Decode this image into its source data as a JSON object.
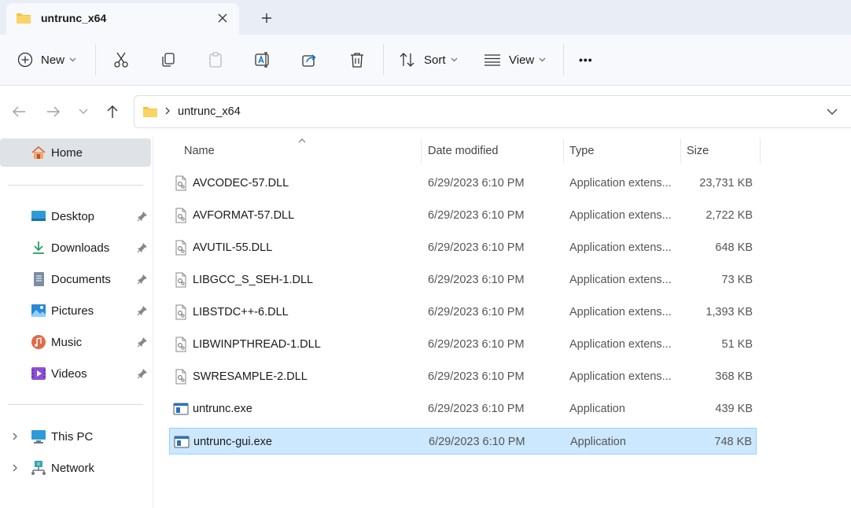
{
  "window": {
    "tab_title": "untrunc_x64"
  },
  "toolbar": {
    "new_label": "New",
    "sort_label": "Sort",
    "view_label": "View",
    "more_label": "•••"
  },
  "address": {
    "path": [
      "untrunc_x64"
    ]
  },
  "sidebar": {
    "home": "Home",
    "quick_access": [
      {
        "label": "Desktop",
        "icon": "desktop-icon"
      },
      {
        "label": "Downloads",
        "icon": "downloads-icon"
      },
      {
        "label": "Documents",
        "icon": "documents-icon"
      },
      {
        "label": "Pictures",
        "icon": "pictures-icon"
      },
      {
        "label": "Music",
        "icon": "music-icon"
      },
      {
        "label": "Videos",
        "icon": "videos-icon"
      }
    ],
    "this_pc": "This PC",
    "network": "Network"
  },
  "columns": {
    "name": "Name",
    "date": "Date modified",
    "type": "Type",
    "size": "Size"
  },
  "files": [
    {
      "name": "AVCODEC-57.DLL",
      "date": "6/29/2023 6:10 PM",
      "type": "Application extens...",
      "size": "23,731 KB",
      "kind": "dll",
      "selected": false
    },
    {
      "name": "AVFORMAT-57.DLL",
      "date": "6/29/2023 6:10 PM",
      "type": "Application extens...",
      "size": "2,722 KB",
      "kind": "dll",
      "selected": false
    },
    {
      "name": "AVUTIL-55.DLL",
      "date": "6/29/2023 6:10 PM",
      "type": "Application extens...",
      "size": "648 KB",
      "kind": "dll",
      "selected": false
    },
    {
      "name": "LIBGCC_S_SEH-1.DLL",
      "date": "6/29/2023 6:10 PM",
      "type": "Application extens...",
      "size": "73 KB",
      "kind": "dll",
      "selected": false
    },
    {
      "name": "LIBSTDC++-6.DLL",
      "date": "6/29/2023 6:10 PM",
      "type": "Application extens...",
      "size": "1,393 KB",
      "kind": "dll",
      "selected": false
    },
    {
      "name": "LIBWINPTHREAD-1.DLL",
      "date": "6/29/2023 6:10 PM",
      "type": "Application extens...",
      "size": "51 KB",
      "kind": "dll",
      "selected": false
    },
    {
      "name": "SWRESAMPLE-2.DLL",
      "date": "6/29/2023 6:10 PM",
      "type": "Application extens...",
      "size": "368 KB",
      "kind": "dll",
      "selected": false
    },
    {
      "name": "untrunc.exe",
      "date": "6/29/2023 6:10 PM",
      "type": "Application",
      "size": "439 KB",
      "kind": "exe",
      "selected": false
    },
    {
      "name": "untrunc-gui.exe",
      "date": "6/29/2023 6:10 PM",
      "type": "Application",
      "size": "748 KB",
      "kind": "exe",
      "selected": true
    }
  ],
  "colors": {
    "accent": "#0067c0",
    "folder": "#f5c342",
    "selection": "#cce8ff"
  }
}
